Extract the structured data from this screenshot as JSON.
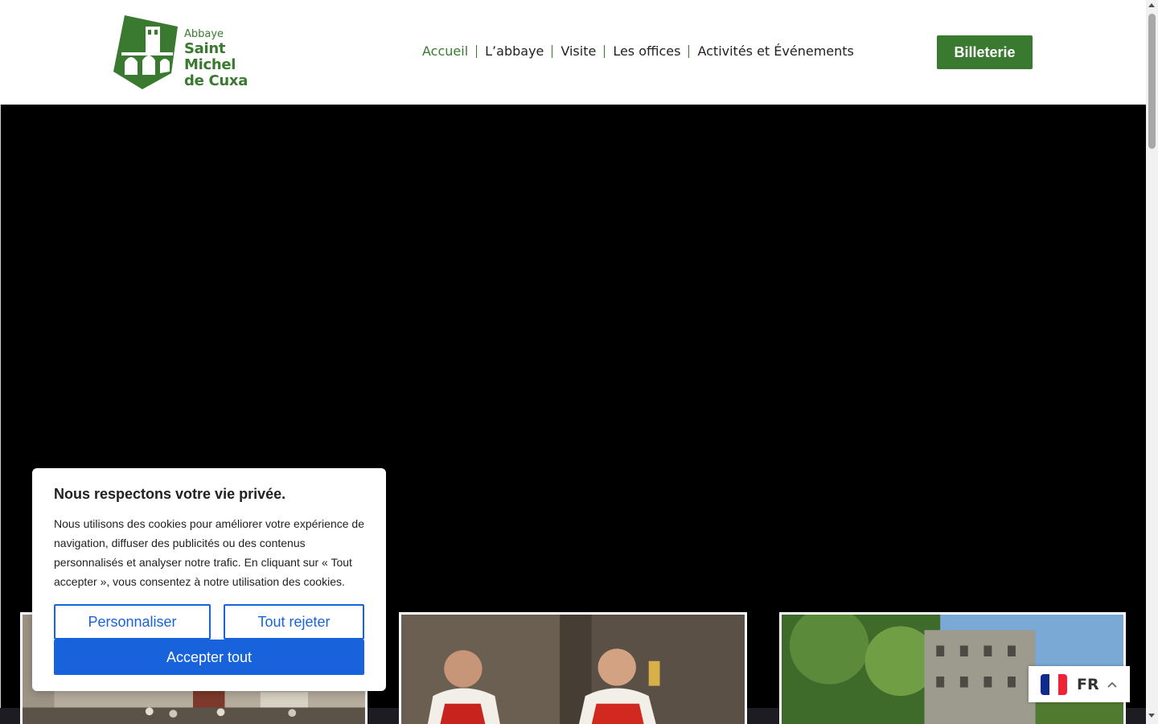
{
  "header": {
    "logo": {
      "line1": "Abbaye",
      "line2": "Saint Michel",
      "line3": "de Cuxa"
    },
    "nav": [
      {
        "label": "Accueil",
        "active": true
      },
      {
        "label": "L’abbaye",
        "active": false
      },
      {
        "label": "Visite",
        "active": false
      },
      {
        "label": "Les offices",
        "active": false
      },
      {
        "label": "Activités et Événements",
        "active": false
      }
    ],
    "cta_label": "Billeterie"
  },
  "cookie_banner": {
    "title": "Nous respectons votre vie privée.",
    "text": "Nous utilisons des cookies pour améliorer votre expérience de navigation, diffuser des publicités ou des contenus personnalisés et analyser notre trafic. En cliquant sur « Tout accepter », vous consentez à notre utilisation des cookies.",
    "customize_label": "Personnaliser",
    "reject_label": "Tout rejeter",
    "accept_label": "Accepter tout"
  },
  "language": {
    "code": "FR",
    "flag_colors": [
      "#0f2b8e",
      "#ffffff",
      "#ee2436"
    ]
  },
  "colors": {
    "brand_green": "#3a7a30",
    "cookie_blue": "#1863dc"
  },
  "icons": {
    "logo": "abbey-tower-logo-icon",
    "flag": "france-flag-icon",
    "chevron": "chevron-up-icon"
  }
}
